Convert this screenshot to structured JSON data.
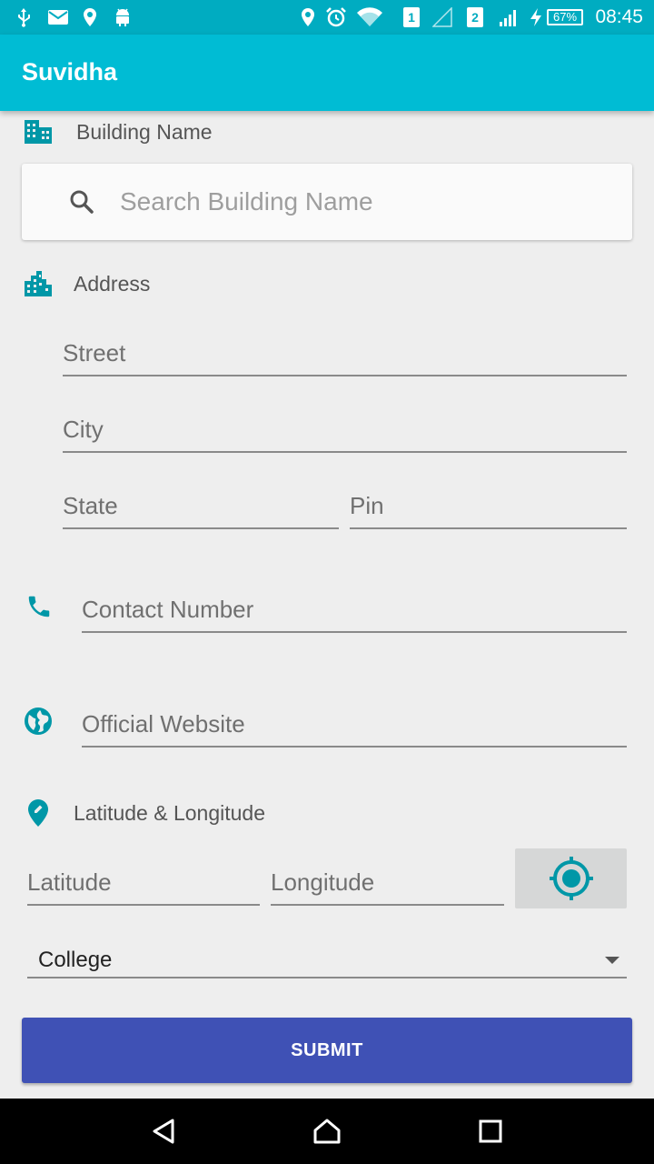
{
  "status_bar": {
    "time": "08:45",
    "battery": "67%",
    "sim1": "1",
    "sim2": "2",
    "icons": [
      "usb-icon",
      "mail-icon",
      "location-icon",
      "android-icon",
      "location-icon",
      "alarm-icon",
      "wifi-icon",
      "signal-icon",
      "charging-icon",
      "battery-icon"
    ]
  },
  "app_bar": {
    "title": "Suvidha"
  },
  "building": {
    "label": "Building Name",
    "search_placeholder": "Search Building Name",
    "search_value": ""
  },
  "address": {
    "label": "Address",
    "street_placeholder": "Street",
    "city_placeholder": "City",
    "state_placeholder": "State",
    "pin_placeholder": "Pin"
  },
  "contact": {
    "placeholder": "Contact Number"
  },
  "website": {
    "placeholder": "Official Website"
  },
  "location": {
    "label": "Latitude & Longitude",
    "latitude_placeholder": "Latitude",
    "longitude_placeholder": "Longitude"
  },
  "category": {
    "selected": "College"
  },
  "submit_label": "SUBMIT",
  "colors": {
    "status_bar": "#00acc1",
    "app_bar": "#00bcd4",
    "accent_icon": "#0097a7",
    "submit": "#3f51b5"
  }
}
